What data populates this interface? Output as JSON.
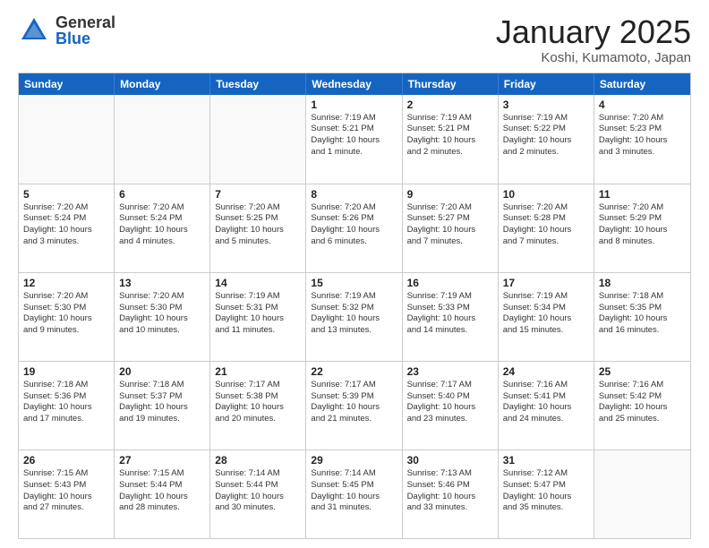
{
  "logo": {
    "general": "General",
    "blue": "Blue"
  },
  "title": "January 2025",
  "location": "Koshi, Kumamoto, Japan",
  "header_days": [
    "Sunday",
    "Monday",
    "Tuesday",
    "Wednesday",
    "Thursday",
    "Friday",
    "Saturday"
  ],
  "weeks": [
    [
      {
        "day": "",
        "info": "",
        "empty": true
      },
      {
        "day": "",
        "info": "",
        "empty": true
      },
      {
        "day": "",
        "info": "",
        "empty": true
      },
      {
        "day": "1",
        "info": "Sunrise: 7:19 AM\nSunset: 5:21 PM\nDaylight: 10 hours\nand 1 minute."
      },
      {
        "day": "2",
        "info": "Sunrise: 7:19 AM\nSunset: 5:21 PM\nDaylight: 10 hours\nand 2 minutes."
      },
      {
        "day": "3",
        "info": "Sunrise: 7:19 AM\nSunset: 5:22 PM\nDaylight: 10 hours\nand 2 minutes."
      },
      {
        "day": "4",
        "info": "Sunrise: 7:20 AM\nSunset: 5:23 PM\nDaylight: 10 hours\nand 3 minutes."
      }
    ],
    [
      {
        "day": "5",
        "info": "Sunrise: 7:20 AM\nSunset: 5:24 PM\nDaylight: 10 hours\nand 3 minutes."
      },
      {
        "day": "6",
        "info": "Sunrise: 7:20 AM\nSunset: 5:24 PM\nDaylight: 10 hours\nand 4 minutes."
      },
      {
        "day": "7",
        "info": "Sunrise: 7:20 AM\nSunset: 5:25 PM\nDaylight: 10 hours\nand 5 minutes."
      },
      {
        "day": "8",
        "info": "Sunrise: 7:20 AM\nSunset: 5:26 PM\nDaylight: 10 hours\nand 6 minutes."
      },
      {
        "day": "9",
        "info": "Sunrise: 7:20 AM\nSunset: 5:27 PM\nDaylight: 10 hours\nand 7 minutes."
      },
      {
        "day": "10",
        "info": "Sunrise: 7:20 AM\nSunset: 5:28 PM\nDaylight: 10 hours\nand 7 minutes."
      },
      {
        "day": "11",
        "info": "Sunrise: 7:20 AM\nSunset: 5:29 PM\nDaylight: 10 hours\nand 8 minutes."
      }
    ],
    [
      {
        "day": "12",
        "info": "Sunrise: 7:20 AM\nSunset: 5:30 PM\nDaylight: 10 hours\nand 9 minutes."
      },
      {
        "day": "13",
        "info": "Sunrise: 7:20 AM\nSunset: 5:30 PM\nDaylight: 10 hours\nand 10 minutes."
      },
      {
        "day": "14",
        "info": "Sunrise: 7:19 AM\nSunset: 5:31 PM\nDaylight: 10 hours\nand 11 minutes."
      },
      {
        "day": "15",
        "info": "Sunrise: 7:19 AM\nSunset: 5:32 PM\nDaylight: 10 hours\nand 13 minutes."
      },
      {
        "day": "16",
        "info": "Sunrise: 7:19 AM\nSunset: 5:33 PM\nDaylight: 10 hours\nand 14 minutes."
      },
      {
        "day": "17",
        "info": "Sunrise: 7:19 AM\nSunset: 5:34 PM\nDaylight: 10 hours\nand 15 minutes."
      },
      {
        "day": "18",
        "info": "Sunrise: 7:18 AM\nSunset: 5:35 PM\nDaylight: 10 hours\nand 16 minutes."
      }
    ],
    [
      {
        "day": "19",
        "info": "Sunrise: 7:18 AM\nSunset: 5:36 PM\nDaylight: 10 hours\nand 17 minutes."
      },
      {
        "day": "20",
        "info": "Sunrise: 7:18 AM\nSunset: 5:37 PM\nDaylight: 10 hours\nand 19 minutes."
      },
      {
        "day": "21",
        "info": "Sunrise: 7:17 AM\nSunset: 5:38 PM\nDaylight: 10 hours\nand 20 minutes."
      },
      {
        "day": "22",
        "info": "Sunrise: 7:17 AM\nSunset: 5:39 PM\nDaylight: 10 hours\nand 21 minutes."
      },
      {
        "day": "23",
        "info": "Sunrise: 7:17 AM\nSunset: 5:40 PM\nDaylight: 10 hours\nand 23 minutes."
      },
      {
        "day": "24",
        "info": "Sunrise: 7:16 AM\nSunset: 5:41 PM\nDaylight: 10 hours\nand 24 minutes."
      },
      {
        "day": "25",
        "info": "Sunrise: 7:16 AM\nSunset: 5:42 PM\nDaylight: 10 hours\nand 25 minutes."
      }
    ],
    [
      {
        "day": "26",
        "info": "Sunrise: 7:15 AM\nSunset: 5:43 PM\nDaylight: 10 hours\nand 27 minutes."
      },
      {
        "day": "27",
        "info": "Sunrise: 7:15 AM\nSunset: 5:44 PM\nDaylight: 10 hours\nand 28 minutes."
      },
      {
        "day": "28",
        "info": "Sunrise: 7:14 AM\nSunset: 5:44 PM\nDaylight: 10 hours\nand 30 minutes."
      },
      {
        "day": "29",
        "info": "Sunrise: 7:14 AM\nSunset: 5:45 PM\nDaylight: 10 hours\nand 31 minutes."
      },
      {
        "day": "30",
        "info": "Sunrise: 7:13 AM\nSunset: 5:46 PM\nDaylight: 10 hours\nand 33 minutes."
      },
      {
        "day": "31",
        "info": "Sunrise: 7:12 AM\nSunset: 5:47 PM\nDaylight: 10 hours\nand 35 minutes."
      },
      {
        "day": "",
        "info": "",
        "empty": true
      }
    ]
  ]
}
